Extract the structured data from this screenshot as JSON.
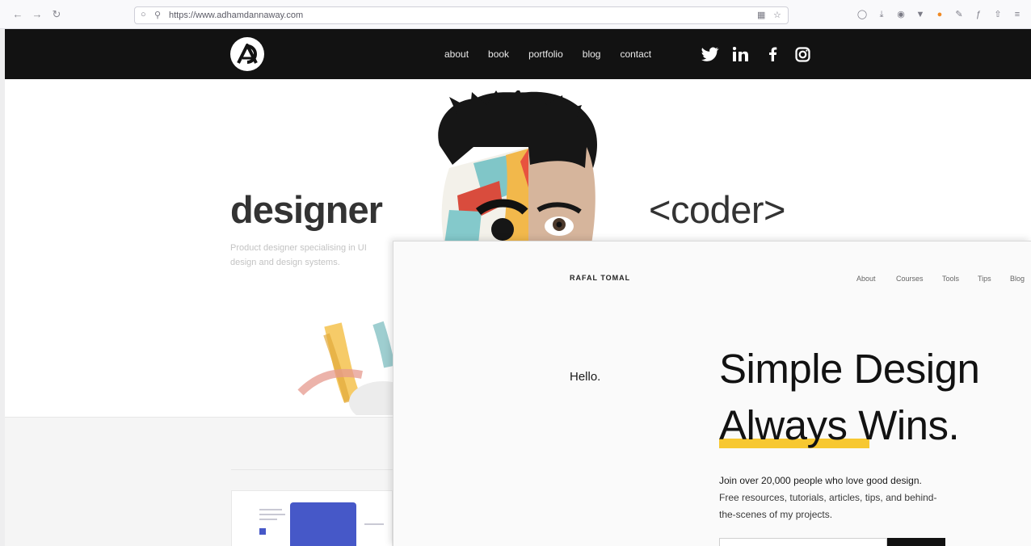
{
  "browser": {
    "url": "https://www.adhamdannaway.com"
  },
  "site": {
    "nav": [
      "about",
      "book",
      "portfolio",
      "blog",
      "contact"
    ],
    "hero": {
      "left_word": "designer",
      "right_word": "<coder>",
      "description": "Product designer specialising in UI design and design systems."
    }
  },
  "rafal": {
    "brand": "RAFAL TOMAL",
    "nav": [
      "About",
      "Courses",
      "Tools",
      "Tips",
      "Blog"
    ],
    "hello": "Hello.",
    "headline_line1": "Simple Design",
    "headline_line2_word1": "Always",
    "headline_line2_word2": "Wins.",
    "paragraph_line1": "Join over 20,000 people who love good design.",
    "paragraph_rest": "Free resources, tutorials, articles, tips, and behind-the-scenes of my projects.",
    "highlight_color": "#f7c831"
  }
}
